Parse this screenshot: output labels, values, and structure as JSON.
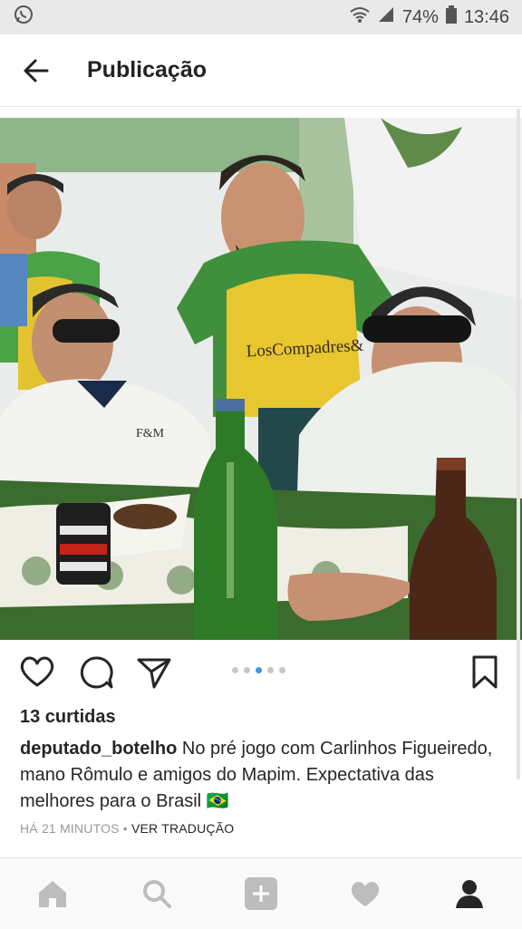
{
  "status": {
    "app_icon": "whatsapp-icon",
    "battery": "74%",
    "time": "13:46"
  },
  "header": {
    "title": "Publicação"
  },
  "post": {
    "photo_shirt_text": "LosCompadres&",
    "carousel_count": 5,
    "carousel_active": 3,
    "likes": "13 curtidas",
    "username": "deputado_botelho",
    "caption": "No pré jogo com Carlinhos Figueiredo, mano Rômulo e amigos do Mapim. Expectativa das melhores para o Brasil",
    "flag": "🇧🇷",
    "time_ago": "HÁ 21 MINUTOS",
    "separator": " • ",
    "translate": "VER TRADUÇÃO"
  },
  "colors": {
    "accent": "#3897f0",
    "bottle_green": "#2f7a26",
    "shirt_yellow": "#e7c630",
    "shirt_green": "#2f8a3a"
  }
}
